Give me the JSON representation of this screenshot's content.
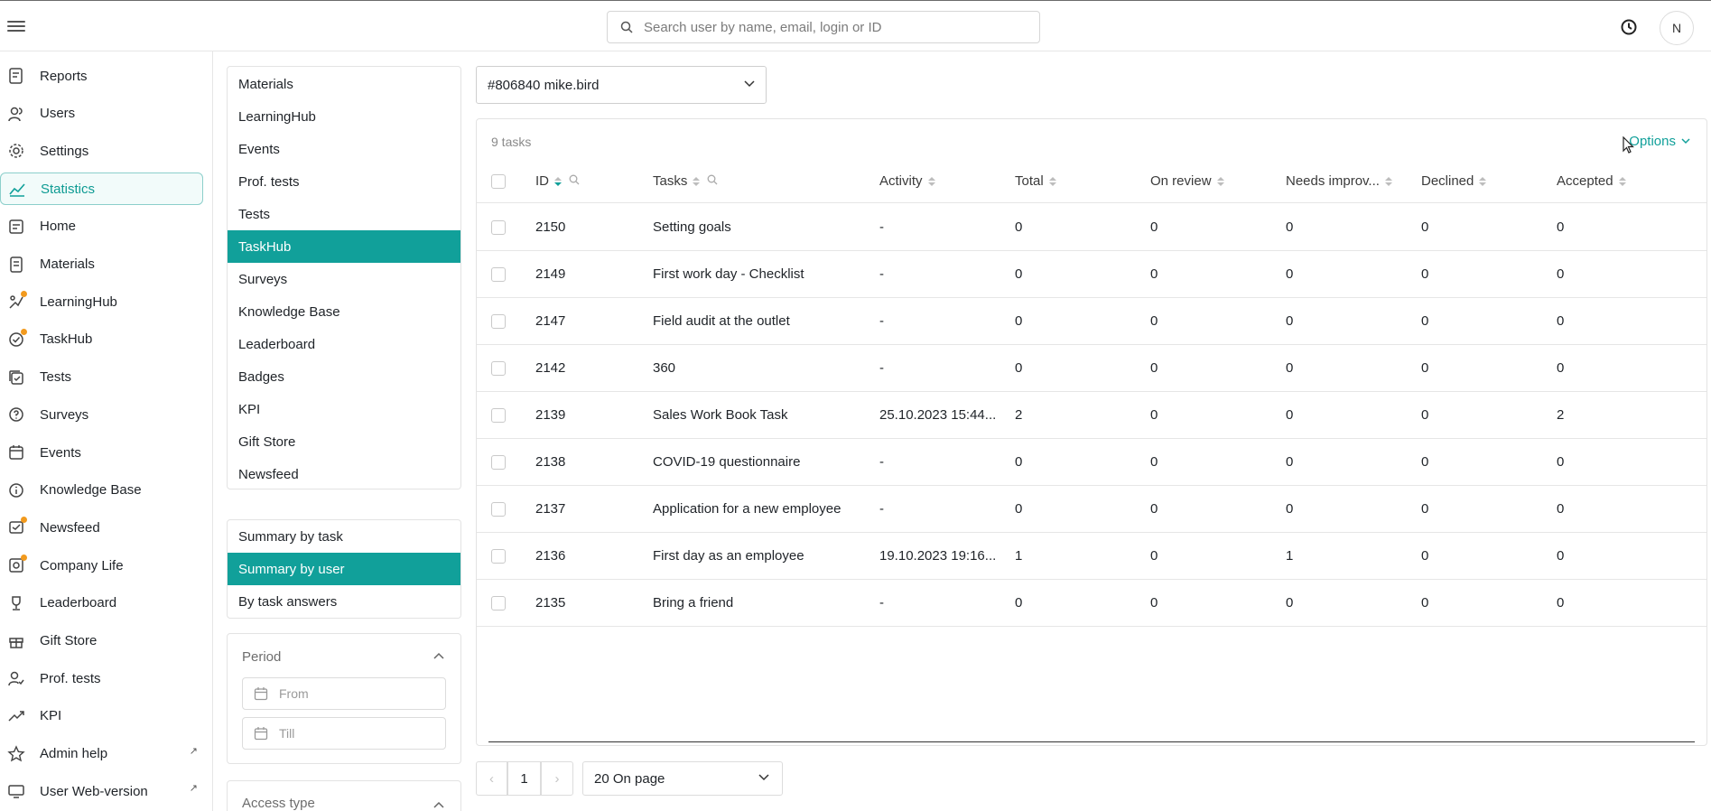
{
  "topbar": {
    "search_placeholder": "Search user by name, email, login or ID",
    "avatar_initial": "N"
  },
  "leftnav": {
    "items": [
      {
        "label": "Reports",
        "icon": "reports-icon"
      },
      {
        "label": "Users",
        "icon": "users-icon"
      },
      {
        "label": "Settings",
        "icon": "gear-icon"
      },
      {
        "label": "Statistics",
        "icon": "chart-line-icon",
        "active": true
      },
      {
        "label": "Home",
        "icon": "home-icon"
      },
      {
        "label": "Materials",
        "icon": "materials-icon"
      },
      {
        "label": "LearningHub",
        "icon": "learninghub-icon",
        "dot": true
      },
      {
        "label": "TaskHub",
        "icon": "taskhub-icon",
        "dot": true
      },
      {
        "label": "Tests",
        "icon": "tests-icon"
      },
      {
        "label": "Surveys",
        "icon": "surveys-icon"
      },
      {
        "label": "Events",
        "icon": "calendar-icon"
      },
      {
        "label": "Knowledge Base",
        "icon": "info-icon"
      },
      {
        "label": "Newsfeed",
        "icon": "newsfeed-icon",
        "dot": true
      },
      {
        "label": "Company Life",
        "icon": "company-life-icon",
        "dot": true
      },
      {
        "label": "Leaderboard",
        "icon": "trophy-icon"
      },
      {
        "label": "Gift Store",
        "icon": "gift-icon"
      },
      {
        "label": "Prof. tests",
        "icon": "prof-tests-icon"
      },
      {
        "label": "KPI",
        "icon": "trend-up-icon"
      },
      {
        "label": "Admin help",
        "icon": "star-icon",
        "external": true
      },
      {
        "label": "User Web-version",
        "icon": "monitor-icon",
        "external": true
      }
    ],
    "external_glyph": "↗"
  },
  "sections": {
    "items": [
      "Materials",
      "LearningHub",
      "Events",
      "Prof. tests",
      "Tests",
      "TaskHub",
      "Surveys",
      "Knowledge Base",
      "Leaderboard",
      "Badges",
      "KPI",
      "Gift Store",
      "Newsfeed"
    ],
    "selected": "TaskHub"
  },
  "reports": {
    "items": [
      "Summary by task",
      "Summary by user",
      "By task answers"
    ],
    "selected": "Summary by user"
  },
  "filters": {
    "period_title": "Period",
    "from_placeholder": "From",
    "till_placeholder": "Till",
    "access_title": "Access type"
  },
  "user_select": {
    "value": "#806840 mike.bird"
  },
  "table": {
    "count_label": "9 tasks",
    "options_label": "Options",
    "columns": [
      "ID",
      "Tasks",
      "Activity",
      "Total",
      "On review",
      "Needs improv...",
      "Declined",
      "Accepted"
    ],
    "rows": [
      {
        "id": "2150",
        "task": "Setting goals",
        "activity": "-",
        "total": "0",
        "on_review": "0",
        "needs_improvement": "0",
        "declined": "0",
        "accepted": "0"
      },
      {
        "id": "2149",
        "task": "First work day - Checklist",
        "activity": "-",
        "total": "0",
        "on_review": "0",
        "needs_improvement": "0",
        "declined": "0",
        "accepted": "0"
      },
      {
        "id": "2147",
        "task": "Field audit at the outlet",
        "activity": "-",
        "total": "0",
        "on_review": "0",
        "needs_improvement": "0",
        "declined": "0",
        "accepted": "0"
      },
      {
        "id": "2142",
        "task": "360",
        "activity": "-",
        "total": "0",
        "on_review": "0",
        "needs_improvement": "0",
        "declined": "0",
        "accepted": "0"
      },
      {
        "id": "2139",
        "task": "Sales Work Book Task",
        "activity": "25.10.2023 15:44...",
        "total": "2",
        "on_review": "0",
        "needs_improvement": "0",
        "declined": "0",
        "accepted": "2"
      },
      {
        "id": "2138",
        "task": "COVID-19 questionnaire",
        "activity": "-",
        "total": "0",
        "on_review": "0",
        "needs_improvement": "0",
        "declined": "0",
        "accepted": "0"
      },
      {
        "id": "2137",
        "task": "Application for a new employee",
        "activity": "-",
        "total": "0",
        "on_review": "0",
        "needs_improvement": "0",
        "declined": "0",
        "accepted": "0"
      },
      {
        "id": "2136",
        "task": "First day as an employee",
        "activity": "19.10.2023 19:16...",
        "total": "1",
        "on_review": "0",
        "needs_improvement": "1",
        "declined": "0",
        "accepted": "0"
      },
      {
        "id": "2135",
        "task": "Bring a friend",
        "activity": "-",
        "total": "0",
        "on_review": "0",
        "needs_improvement": "0",
        "declined": "0",
        "accepted": "0"
      }
    ]
  },
  "pagination": {
    "prev": "‹",
    "page": "1",
    "next": "›",
    "per_page": "20 On page"
  },
  "colors": {
    "accent": "#11a09a",
    "notification_dot": "#f29a1e"
  }
}
